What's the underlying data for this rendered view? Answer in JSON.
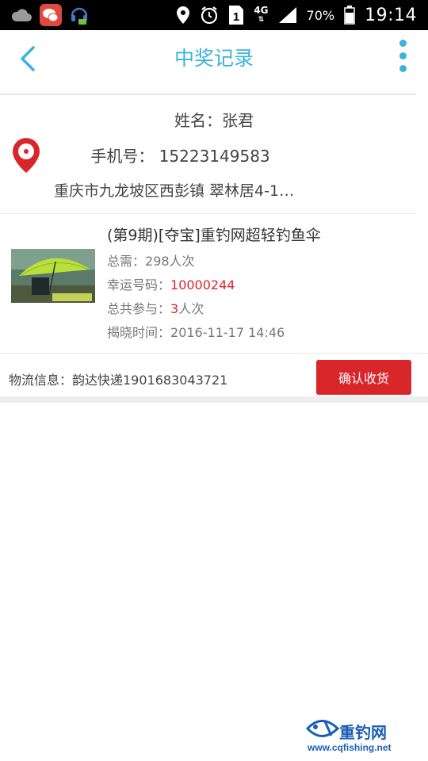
{
  "status_bar": {
    "network": "4G",
    "battery": "70%",
    "time": "19:14"
  },
  "nav": {
    "title": "中奖记录"
  },
  "address": {
    "name": "姓名：张君",
    "phone": "手机号： 15223149583",
    "address": "重庆市九龙坡区西彭镇 翠林居4-1…"
  },
  "product": {
    "title": "(第9期)[夺宝]重钓网超轻钓鱼伞",
    "total_label": "总需：",
    "total_value": "298人次",
    "lucky_label": "幸运号码：",
    "lucky_value": "10000244",
    "join_label": "总共参与：",
    "join_value": "3",
    "join_unit": "人次",
    "reveal_label": "揭晓时间：",
    "reveal_value": "2016-11-17 14:46"
  },
  "logistics": {
    "text": "物流信息：韵达快递1901683043721",
    "confirm_label": "确认收货"
  },
  "watermark": {
    "brand": "重钓网",
    "url": "www.cqfishing.net"
  },
  "colors": {
    "accent": "#3bb3dd",
    "red": "#d8262b"
  }
}
